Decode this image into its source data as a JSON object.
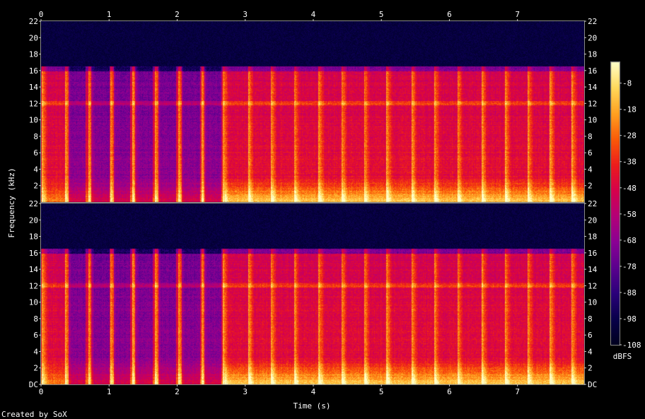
{
  "chart_data": {
    "type": "heatmap",
    "title": "",
    "xlabel": "Time (s)",
    "ylabel": "Frequency (kHz)",
    "xlim": [
      0,
      7.98
    ],
    "ylim": [
      0,
      22
    ],
    "x_ticks": [
      "0",
      "1",
      "2",
      "3",
      "4",
      "5",
      "6",
      "7"
    ],
    "y_ticks": [
      "DC",
      "2",
      "4",
      "6",
      "8",
      "10",
      "12",
      "14",
      "16",
      "18",
      "20",
      "22"
    ],
    "channels": 2,
    "colorbar": {
      "label": "dBFS",
      "ticks": [
        "-8",
        "-18",
        "-28",
        "-38",
        "-48",
        "-58",
        "-68",
        "-78",
        "-88",
        "-98",
        "-108"
      ],
      "range": [
        -108,
        0
      ],
      "palette": [
        "#00001e",
        "#08004a",
        "#2a007a",
        "#5a008e",
        "#8a0094",
        "#b30078",
        "#d6004c",
        "#ec1c1c",
        "#fa5a08",
        "#ffa020",
        "#ffd85a",
        "#ffffc8"
      ]
    },
    "content_cutoff_khz": 16.3,
    "tonal_band_khz": 12.1,
    "onsets_s": [
      0.02,
      0.36,
      0.7,
      1.02,
      1.35,
      1.68,
      2.02,
      2.36,
      2.68,
      3.05,
      3.38,
      3.72,
      4.08,
      4.42,
      4.75,
      5.08,
      5.45,
      5.78,
      6.12,
      6.48,
      6.82,
      7.15,
      7.48,
      7.8
    ],
    "noise_gaps": [
      [
        0.4,
        0.65
      ],
      [
        0.73,
        1.0
      ],
      [
        1.06,
        1.3
      ],
      [
        1.38,
        1.64
      ],
      [
        1.72,
        1.98
      ],
      [
        2.06,
        2.33
      ],
      [
        2.4,
        2.64
      ]
    ]
  },
  "footer": {
    "credit": "Created by SoX"
  }
}
